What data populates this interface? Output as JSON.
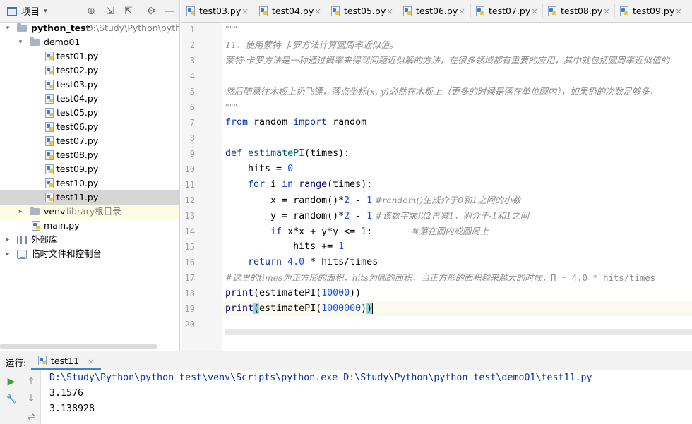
{
  "project_panel": {
    "title": "项目",
    "tree": [
      {
        "type": "root",
        "label": "python_test",
        "path": "D:\\Study\\Python\\pytho"
      },
      {
        "type": "folder",
        "label": "demo01"
      },
      {
        "type": "file",
        "label": "test01.py"
      },
      {
        "type": "file",
        "label": "test02.py"
      },
      {
        "type": "file",
        "label": "test03.py"
      },
      {
        "type": "file",
        "label": "test04.py"
      },
      {
        "type": "file",
        "label": "test05.py"
      },
      {
        "type": "file",
        "label": "test06.py"
      },
      {
        "type": "file",
        "label": "test07.py"
      },
      {
        "type": "file",
        "label": "test08.py"
      },
      {
        "type": "file",
        "label": "test09.py"
      },
      {
        "type": "file",
        "label": "test10.py"
      },
      {
        "type": "file",
        "label": "test11.py",
        "selected": true
      },
      {
        "type": "venv",
        "label": "venv",
        "note": "library根目录"
      },
      {
        "type": "file",
        "label": "main.py"
      },
      {
        "type": "lib",
        "label": "外部库"
      },
      {
        "type": "scratch",
        "label": "临时文件和控制台"
      }
    ]
  },
  "tabs": [
    "test03.py",
    "test04.py",
    "test05.py",
    "test06.py",
    "test07.py",
    "test08.py",
    "test09.py"
  ],
  "editor": {
    "line_numbers": [
      "1",
      "2",
      "3",
      "4",
      "5",
      "6",
      "7",
      "8",
      "9",
      "10",
      "11",
      "12",
      "13",
      "14",
      "15",
      "16",
      "17",
      "18",
      "19",
      "20"
    ],
    "doc": {
      "l1": "\"\"\"",
      "l2": "11、使用蒙特·卡罗方法计算圆周率近似值。",
      "l3": "蒙特·卡罗方法是一种通过概率来得到问题近似解的方法，在很多领域都有重要的应用，其中就包括圆周率近似值的",
      "l5": "然后随意往木板上扔飞镖，落点坐标(x, y)必然在木板上（更多的时候是落在单位圆内），如果扔的次数足够多，",
      "l6": "\"\"\""
    },
    "code": {
      "l7": {
        "kw1": "from",
        "mod": " random ",
        "kw2": "import",
        "name": " random"
      },
      "l9": {
        "kw": "def",
        "fn": "estimatePI",
        "rest": "(times):"
      },
      "l10": {
        "text": "    hits = ",
        "num": "0"
      },
      "l11": {
        "indent": "    ",
        "kw1": "for",
        "var": " i ",
        "kw2": "in",
        "sp": " ",
        "bi": "range",
        "rest": "(times):"
      },
      "l12": {
        "text": "        x = random()*",
        "n1": "2",
        "op": " - ",
        "n2": "1",
        "cm": " #random()生成介于0和1之间的小数"
      },
      "l13": {
        "text": "        y = random()*",
        "n1": "2",
        "op": " - ",
        "n2": "1",
        "cm": " #该数字乘以2再减1，则介于-1和1之间"
      },
      "l14": {
        "indent": "        ",
        "kw": "if",
        "text": " x*x + y*y <= ",
        "num": "1",
        "colon": ":",
        "pad": "       ",
        "cm": "#落在圆内或圆周上"
      },
      "l15": {
        "text": "            hits += ",
        "num": "1"
      },
      "l16": {
        "indent": "    ",
        "kw": "return",
        "sp": " ",
        "num": "4.0",
        "rest": " * hits/times"
      },
      "l17": {
        "cm": "#这里的times为正方形的面积，hits为圆的面积，当正方形的面积越来越大的时候，",
        "code": "Π = 4.0 * hits/times"
      },
      "l18": {
        "bi": "print",
        "rest": "(estimatePI(",
        "num": "10000",
        "close": "))"
      },
      "l19": {
        "bi": "print",
        "open": "(",
        "mid": "estimatePI(",
        "num": "1000000",
        "close1": ")",
        "close2": ")"
      }
    }
  },
  "run_window": {
    "label": "运行:",
    "tab": "test11",
    "output": [
      "D:\\Study\\Python\\python_test\\venv\\Scripts\\python.exe D:\\Study\\Python\\python_test\\demo01\\test11.py",
      "3.1576",
      "3.138928"
    ],
    "output_color": "#0033b3"
  },
  "icons": {
    "locate": "⊕",
    "expand_all": "⇲",
    "collapse_all": "⇱",
    "settings": "⚙",
    "minimize": "—",
    "run": "▶",
    "wrench": "🔧",
    "up": "↑",
    "down": "↓",
    "wrap": "⇌",
    "close": "×",
    "arrow_down": "▾",
    "arrow_right": "▸",
    "caret": "▾"
  }
}
